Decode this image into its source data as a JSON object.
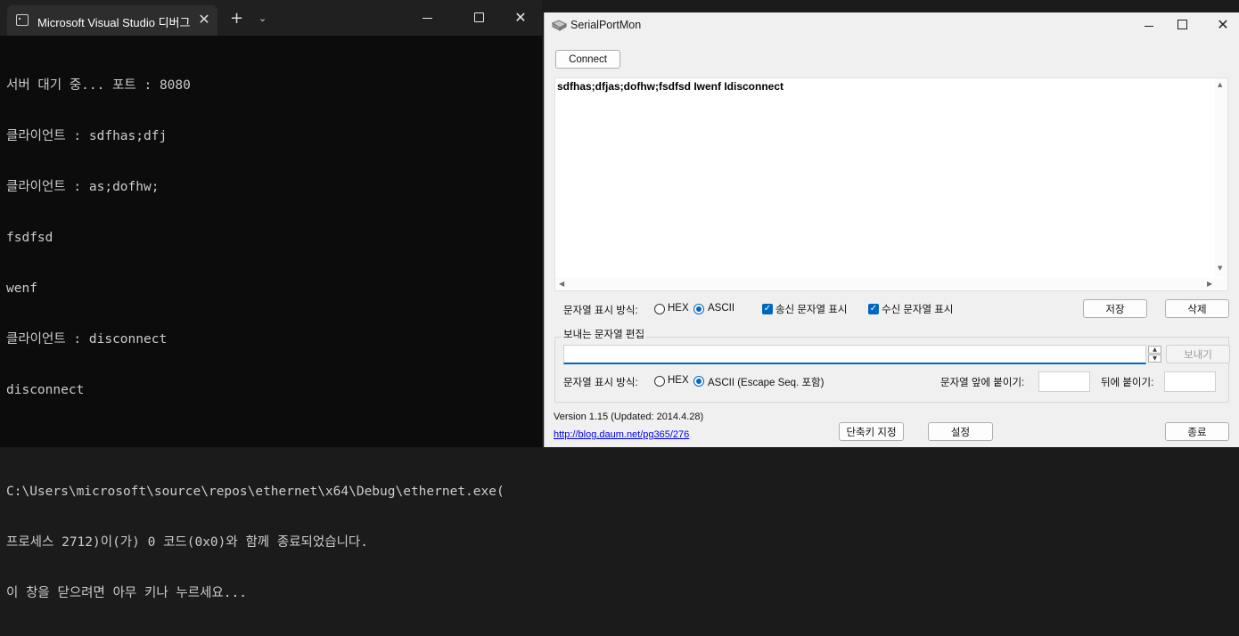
{
  "terminal": {
    "tab_title": "Microsoft Visual Studio 디버그",
    "tab_close": "✕",
    "new_tab": "+",
    "dropdown": "⌄",
    "close": "✕",
    "lines": [
      "서버 대기 중... 포트 : 8080",
      "클라이언트 : sdfhas;dfj",
      "클라이언트 : as;dofhw;",
      "fsdfsd",
      "wenf",
      "클라이언트 : disconnect",
      "disconnect",
      "",
      "C:\\Users\\microsoft\\source\\repos\\ethernet\\x64\\Debug\\ethernet.exe(",
      "프로세스 2712)이(가) 0 코드(0x0)와 함께 종료되었습니다.",
      "이 창을 닫으려면 아무 키나 누르세요..."
    ]
  },
  "serial": {
    "title": "SerialPortMon",
    "close": "✕",
    "connect_label": "Connect",
    "received_text": "sdfhas;dfjas;dofhw;fsdfsd Iwenf Idisconnect",
    "display_mode_label": "문자열 표시 방식:",
    "hex_label": "HEX",
    "ascii_label": "ASCII",
    "show_sent_label": "송신 문자열 표시",
    "show_recv_label": "수신 문자열 표시",
    "save_label": "저장",
    "delete_label": "삭제",
    "send_group_title": "보내는 문자열 편집",
    "send_value": "",
    "send_button": "보내기",
    "send_display_mode_label": "문자열 표시 방식:",
    "send_hex_label": "HEX",
    "send_ascii_label": "ASCII (Escape Seq. 포함)",
    "prefix_label": "문자열 앞에 붙이기:",
    "suffix_label": "뒤에 붙이기:",
    "prefix_value": "",
    "suffix_value": "",
    "version": "Version 1.15 (Updated: 2014.4.28)",
    "link": "http://blog.daum.net/pg365/276",
    "shortcut_label": "단축키 지정",
    "settings_label": "설정",
    "exit_label": "종료",
    "show_sent_checked": true,
    "show_recv_checked": true,
    "display_mode_selected": "ASCII",
    "send_mode_selected": "ASCII (Escape Seq. 포함)",
    "accent_color": "#0067c0"
  }
}
